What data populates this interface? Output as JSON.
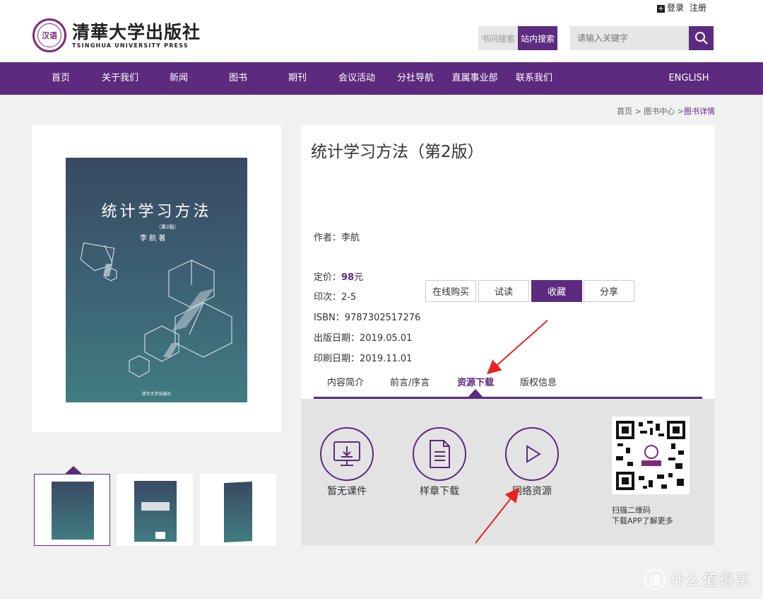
{
  "header": {
    "logo_seal": "汉语",
    "logo_cn": "清華大学出版社",
    "logo_en": "TSINGHUA UNIVERSITY PRESS",
    "login": "登录",
    "register": "注册",
    "search_tab_q": "书问搜索",
    "search_tab_site": "站内搜索",
    "search_placeholder": "请输入关键字"
  },
  "nav": {
    "items": [
      "首页",
      "关于我们",
      "新闻",
      "图书",
      "期刊",
      "会议活动",
      "分社导航",
      "直属事业部",
      "联系我们"
    ],
    "english": "ENGLISH"
  },
  "breadcrumb": {
    "home": "首页",
    "sep": ">",
    "center": "图书中心",
    "current": "图书详情"
  },
  "cover": {
    "title": "统计学习方法",
    "edition": "（第2版）",
    "author": "李 航 著",
    "publisher": "清华大学出版社"
  },
  "book": {
    "title": "统计学习方法（第2版）",
    "author_label": "作者：",
    "author": "李航",
    "price_label": "定价：",
    "price": "98",
    "price_unit": "元",
    "print_label": "印次：",
    "print": "2-5",
    "isbn_label": "ISBN：",
    "isbn": "9787302517276",
    "pub_date_label": "出版日期：",
    "pub_date": "2019.05.01",
    "print_date_label": "印刷日期：",
    "print_date": "2019.11.01"
  },
  "actions": {
    "buy": "在线购买",
    "try": "试读",
    "fav": "收藏",
    "share": "分享"
  },
  "tabs": [
    "内容简介",
    "前言/序言",
    "资源下载",
    "版权信息"
  ],
  "resources": {
    "courseware": "暂无课件",
    "sample": "样章下载",
    "network": "网络资源"
  },
  "qr": {
    "caption1": "扫描二维码",
    "caption2": "下载APP了解更多"
  },
  "watermark": {
    "icon": "值",
    "text": "什么值得买"
  },
  "colors": {
    "brand": "#5c2a7e",
    "annotation": "#e8231f"
  }
}
